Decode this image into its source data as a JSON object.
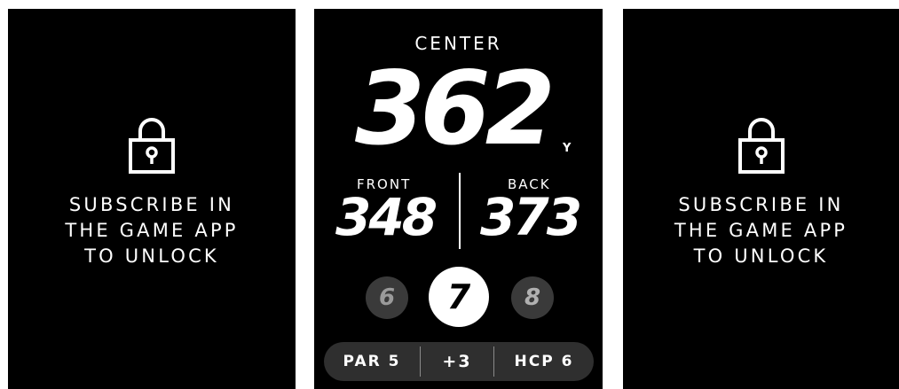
{
  "panels": {
    "left": {
      "lock_icon": "lock-icon",
      "message_lines": [
        "SUBSCRIBE IN",
        "THE GAME APP",
        "TO UNLOCK"
      ]
    },
    "middle": {
      "center_label": "CENTER",
      "center_yards": "362",
      "yards_unit": "Y",
      "front_label": "FRONT",
      "front_yards": "348",
      "back_label": "BACK",
      "back_yards": "373",
      "holes": {
        "previous": "6",
        "current": "7",
        "next": "8"
      },
      "info_bar": {
        "par": "PAR 5",
        "score": "+3",
        "hcp": "HCP 6"
      }
    },
    "right": {
      "lock_icon": "lock-icon",
      "message_lines": [
        "SUBSCRIBE IN",
        "THE GAME APP",
        "TO UNLOCK"
      ]
    }
  },
  "colors": {
    "screen_background": "#000000",
    "text": "#ffffff",
    "inactive_hole": "#3a3a3a",
    "info_bar": "#2f2f2f"
  }
}
